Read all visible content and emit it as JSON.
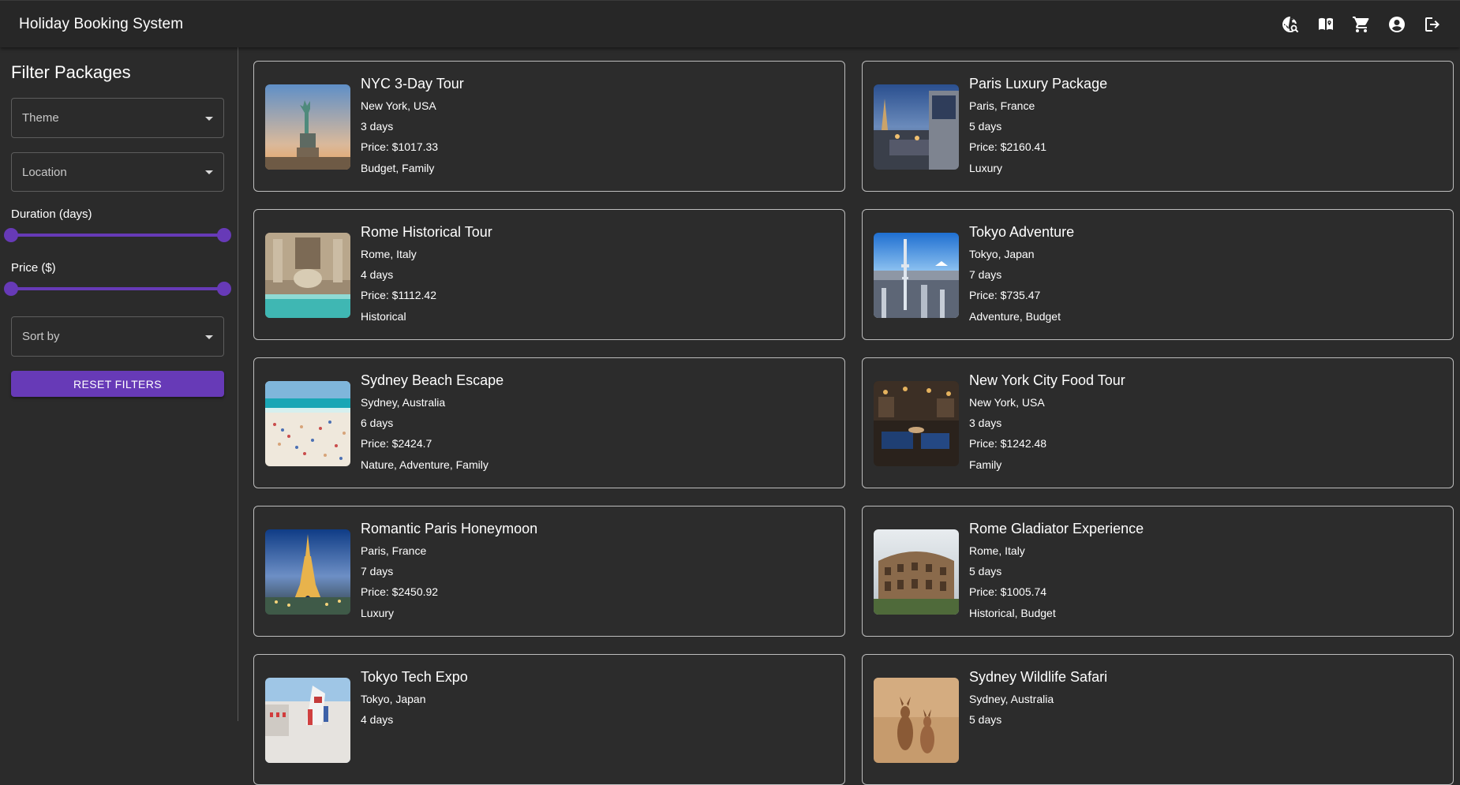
{
  "app": {
    "title": "Holiday Booking System",
    "icons": [
      "travel-explore-icon",
      "map-book-icon",
      "shopping-cart-icon",
      "account-circle-icon",
      "logout-icon"
    ]
  },
  "colors": {
    "accent": "#673ab7",
    "background": "#2b2b2b",
    "appbar": "#272727",
    "card_border": "#bdbdbd"
  },
  "sidebar": {
    "title": "Filter Packages",
    "theme_label": "Theme",
    "location_label": "Location",
    "duration_label": "Duration (days)",
    "duration_range_fraction": [
      0,
      1
    ],
    "price_label": "Price ($)",
    "price_range_fraction": [
      0,
      1
    ],
    "sort_label": "Sort by",
    "reset_label": "RESET FILTERS"
  },
  "packages": [
    {
      "title": "NYC 3-Day Tour",
      "location": "New York, USA",
      "duration": "3 days",
      "price": "Price: $1017.33",
      "tags": "Budget, Family",
      "image": "statue-of-liberty"
    },
    {
      "title": "Paris Luxury Package",
      "location": "Paris, France",
      "duration": "5 days",
      "price": "Price: $2160.41",
      "tags": "Luxury",
      "image": "paris-terrace-night"
    },
    {
      "title": "Rome Historical Tour",
      "location": "Rome, Italy",
      "duration": "4 days",
      "price": "Price: $1112.42",
      "tags": "Historical",
      "image": "trevi-fountain"
    },
    {
      "title": "Tokyo Adventure",
      "location": "Tokyo, Japan",
      "duration": "7 days",
      "price": "Price: $735.47",
      "tags": "Adventure, Budget",
      "image": "tokyo-skytree"
    },
    {
      "title": "Sydney Beach Escape",
      "location": "Sydney, Australia",
      "duration": "6 days",
      "price": "Price: $2424.7",
      "tags": "Nature, Adventure, Family",
      "image": "bondi-beach"
    },
    {
      "title": "New York City Food Tour",
      "location": "New York, USA",
      "duration": "3 days",
      "price": "Price: $1242.48",
      "tags": "Family",
      "image": "restaurant-interior"
    },
    {
      "title": "Romantic Paris Honeymoon",
      "location": "Paris, France",
      "duration": "7 days",
      "price": "Price: $2450.92",
      "tags": "Luxury",
      "image": "eiffel-tower-night"
    },
    {
      "title": "Rome Gladiator Experience",
      "location": "Rome, Italy",
      "duration": "5 days",
      "price": "Price: $1005.74",
      "tags": "Historical, Budget",
      "image": "colosseum"
    },
    {
      "title": "Tokyo Tech Expo",
      "location": "Tokyo, Japan",
      "duration": "4 days",
      "price": "",
      "tags": "",
      "image": "gundam-statue"
    },
    {
      "title": "Sydney Wildlife Safari",
      "location": "Sydney, Australia",
      "duration": "5 days",
      "price": "",
      "tags": "",
      "image": "kangaroos"
    }
  ]
}
